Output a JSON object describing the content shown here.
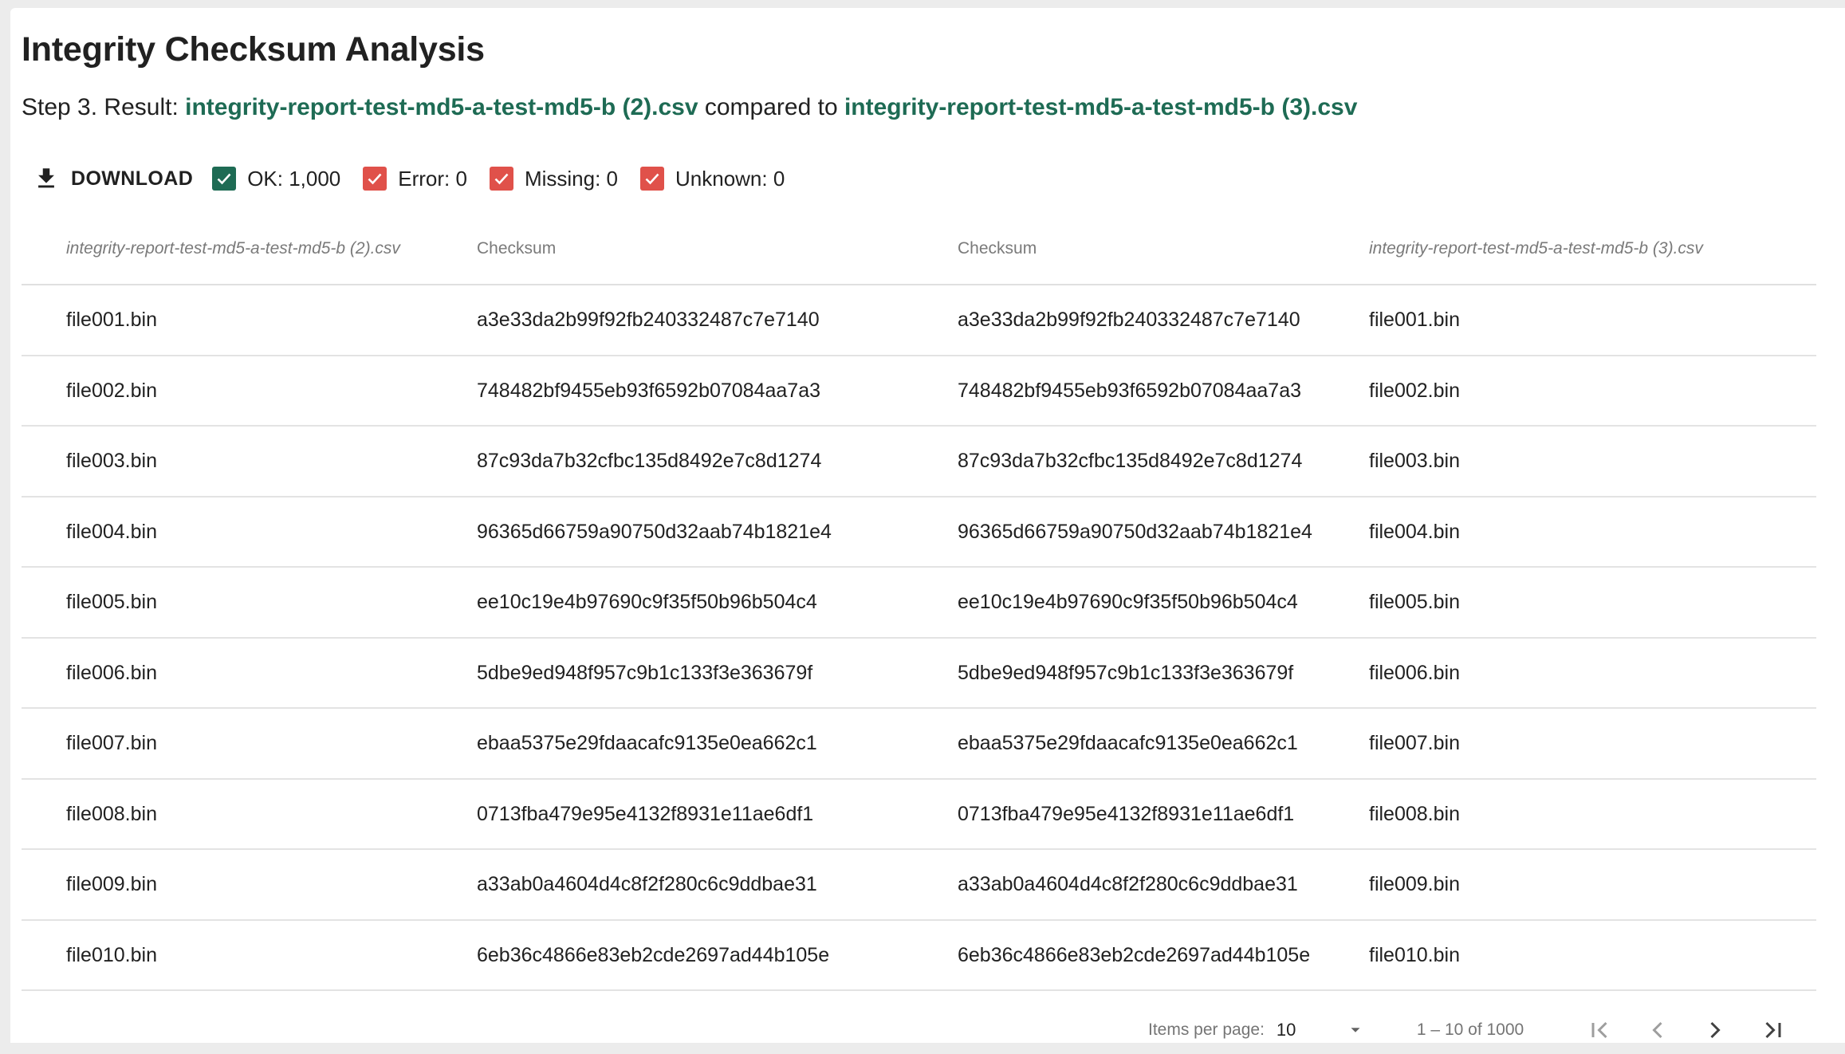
{
  "page_title": "Integrity Checksum Analysis",
  "subtitle": {
    "prefix": "Step 3. Result: ",
    "file_a": "integrity-report-test-md5-a-test-md5-b (2).csv",
    "middle": " compared to ",
    "file_b": "integrity-report-test-md5-a-test-md5-b (3).csv"
  },
  "toolbar": {
    "download_label": "DOWNLOAD",
    "download_icon": "download-icon",
    "filters": [
      {
        "label": "OK: 1,000",
        "checked": true,
        "color": "#1e6b54"
      },
      {
        "label": "Error: 0",
        "checked": true,
        "color": "#e0514a"
      },
      {
        "label": "Missing: 0",
        "checked": true,
        "color": "#e0514a"
      },
      {
        "label": "Unknown: 0",
        "checked": true,
        "color": "#e0514a"
      }
    ]
  },
  "table": {
    "headers": [
      "integrity-report-test-md5-a-test-md5-b (2).csv",
      "Checksum",
      "Checksum",
      "integrity-report-test-md5-a-test-md5-b (3).csv"
    ],
    "rows": [
      [
        "file001.bin",
        "a3e33da2b99f92fb240332487c7e7140",
        "a3e33da2b99f92fb240332487c7e7140",
        "file001.bin"
      ],
      [
        "file002.bin",
        "748482bf9455eb93f6592b07084aa7a3",
        "748482bf9455eb93f6592b07084aa7a3",
        "file002.bin"
      ],
      [
        "file003.bin",
        "87c93da7b32cfbc135d8492e7c8d1274",
        "87c93da7b32cfbc135d8492e7c8d1274",
        "file003.bin"
      ],
      [
        "file004.bin",
        "96365d66759a90750d32aab74b1821e4",
        "96365d66759a90750d32aab74b1821e4",
        "file004.bin"
      ],
      [
        "file005.bin",
        "ee10c19e4b97690c9f35f50b96b504c4",
        "ee10c19e4b97690c9f35f50b96b504c4",
        "file005.bin"
      ],
      [
        "file006.bin",
        "5dbe9ed948f957c9b1c133f3e363679f",
        "5dbe9ed948f957c9b1c133f3e363679f",
        "file006.bin"
      ],
      [
        "file007.bin",
        "ebaa5375e29fdaacafc9135e0ea662c1",
        "ebaa5375e29fdaacafc9135e0ea662c1",
        "file007.bin"
      ],
      [
        "file008.bin",
        "0713fba479e95e4132f8931e11ae6df1",
        "0713fba479e95e4132f8931e11ae6df1",
        "file008.bin"
      ],
      [
        "file009.bin",
        "a33ab0a4604d4c8f2f280c6c9ddbae31",
        "a33ab0a4604d4c8f2f280c6c9ddbae31",
        "file009.bin"
      ],
      [
        "file010.bin",
        "6eb36c4866e83eb2cde2697ad44b105e",
        "6eb36c4866e83eb2cde2697ad44b105e",
        "file010.bin"
      ]
    ]
  },
  "paginator": {
    "items_per_page_label": "Items per page:",
    "page_size": "10",
    "range_label": "1 – 10 of 1000"
  },
  "colors": {
    "accent": "#1e6b54",
    "error": "#e0514a"
  }
}
